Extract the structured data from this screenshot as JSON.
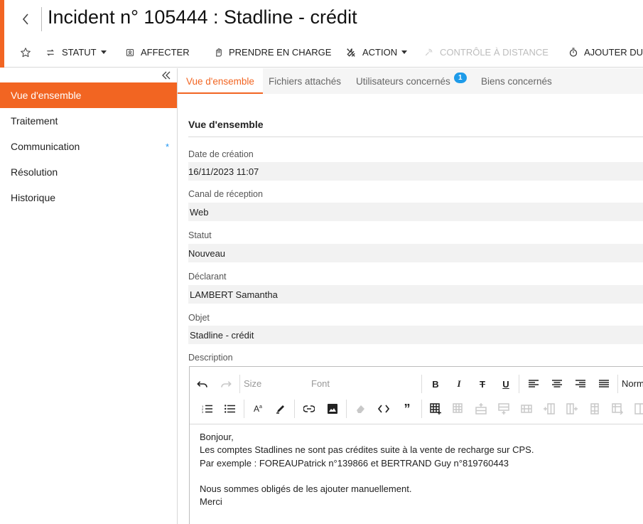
{
  "header": {
    "title": "Incident n° 105444 : Stadline - crédit",
    "accent_color": "#f26522"
  },
  "toolbar": {
    "statut": "STATUT",
    "affecter": "AFFECTER",
    "prendre_en_charge": "PRENDRE EN CHARGE",
    "action": "ACTION",
    "controle_a_distance": "CONTRÔLE À DISTANCE",
    "ajouter": "AJOUTER DU T"
  },
  "sidebar": {
    "items": [
      {
        "label": "Vue d'ensemble"
      },
      {
        "label": "Traitement"
      },
      {
        "label": "Communication"
      },
      {
        "label": "Résolution"
      },
      {
        "label": "Historique"
      }
    ],
    "communication_marker": "*"
  },
  "tabs": [
    {
      "label": "Vue d'ensemble"
    },
    {
      "label": "Fichiers attachés"
    },
    {
      "label": "Utilisateurs concernés",
      "badge": "1"
    },
    {
      "label": "Biens concernés"
    }
  ],
  "section": {
    "title": "Vue d'ensemble"
  },
  "fields": {
    "date_creation": {
      "label": "Date de création",
      "value": "16/11/2023 11:07"
    },
    "canal": {
      "label": "Canal de réception",
      "value": "Web"
    },
    "statut": {
      "label": "Statut",
      "value": "Nouveau"
    },
    "declarant": {
      "label": "Déclarant",
      "value": "LAMBERT Samantha"
    },
    "objet": {
      "label": "Objet",
      "value": "Stadline - crédit"
    },
    "description": {
      "label": "Description"
    }
  },
  "editor": {
    "size_placeholder": "Size",
    "font_placeholder": "Font",
    "format_label": "Norm",
    "body_lines": [
      "Bonjour,",
      "Les comptes Stadlines ne sont pas crédites suite à la vente de recharge sur CPS.",
      "Par exemple : FOREAUPatrick n°139866 et BERTRAND Guy n°819760443",
      "",
      "Nous sommes obligés de les ajouter manuellement.",
      "Merci"
    ]
  }
}
